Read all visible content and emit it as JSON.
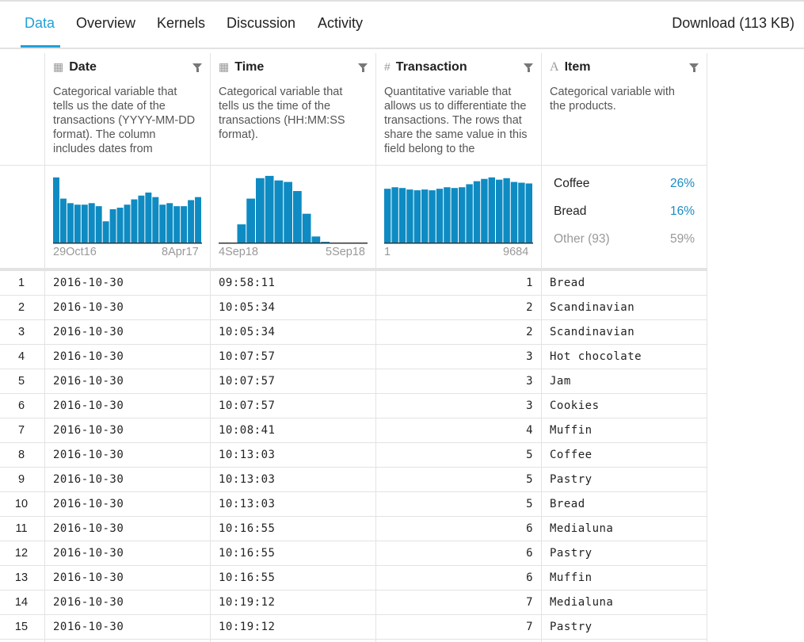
{
  "tabs": [
    {
      "label": "Data",
      "active": true
    },
    {
      "label": "Overview",
      "active": false
    },
    {
      "label": "Kernels",
      "active": false
    },
    {
      "label": "Discussion",
      "active": false
    },
    {
      "label": "Activity",
      "active": false
    }
  ],
  "download_label": "Download (113 KB)",
  "columns": [
    {
      "name": "Date",
      "icon": "calendar-icon",
      "description": "Categorical variable that tells us the date of the transactions (YYYY-MM-DD format). The column includes dates from",
      "axis_min": "29Oct16",
      "axis_max": "8Apr17"
    },
    {
      "name": "Time",
      "icon": "calendar-icon",
      "description": "Categorical variable that tells us the time of the transactions (HH:MM:SS format).",
      "axis_min": "4Sep18",
      "axis_max": "5Sep18"
    },
    {
      "name": "Transaction",
      "icon": "hash-icon",
      "description": "Quantitative variable that allows us to differentiate the transactions. The rows that share the same value in this field belong to the",
      "axis_min": "1",
      "axis_max": "9684"
    },
    {
      "name": "Item",
      "icon": "text-type-icon",
      "description": "Categorical variable with the products."
    }
  ],
  "histograms": {
    "date": [
      86,
      58,
      52,
      50,
      50,
      52,
      48,
      28,
      44,
      46,
      50,
      57,
      62,
      66,
      60,
      50,
      52,
      48,
      48,
      56,
      60
    ],
    "time": [
      0,
      0,
      24,
      58,
      85,
      88,
      82,
      80,
      68,
      38,
      8,
      1,
      0,
      0,
      0,
      0
    ],
    "transaction": [
      71,
      73,
      72,
      70,
      69,
      70,
      69,
      71,
      73,
      72,
      73,
      77,
      81,
      84,
      86,
      83,
      85,
      80,
      79,
      78
    ],
    "bar_color": "#0e8bc2"
  },
  "item_stats": [
    {
      "name": "Coffee",
      "pct": "26%"
    },
    {
      "name": "Bread",
      "pct": "16%"
    },
    {
      "name": "Other (93)",
      "pct": "59%"
    }
  ],
  "rows": [
    {
      "i": "1",
      "date": "2016-10-30",
      "time": "09:58:11",
      "tx": "1",
      "item": "Bread"
    },
    {
      "i": "2",
      "date": "2016-10-30",
      "time": "10:05:34",
      "tx": "2",
      "item": "Scandinavian"
    },
    {
      "i": "3",
      "date": "2016-10-30",
      "time": "10:05:34",
      "tx": "2",
      "item": "Scandinavian"
    },
    {
      "i": "4",
      "date": "2016-10-30",
      "time": "10:07:57",
      "tx": "3",
      "item": "Hot chocolate"
    },
    {
      "i": "5",
      "date": "2016-10-30",
      "time": "10:07:57",
      "tx": "3",
      "item": "Jam"
    },
    {
      "i": "6",
      "date": "2016-10-30",
      "time": "10:07:57",
      "tx": "3",
      "item": "Cookies"
    },
    {
      "i": "7",
      "date": "2016-10-30",
      "time": "10:08:41",
      "tx": "4",
      "item": "Muffin"
    },
    {
      "i": "8",
      "date": "2016-10-30",
      "time": "10:13:03",
      "tx": "5",
      "item": "Coffee"
    },
    {
      "i": "9",
      "date": "2016-10-30",
      "time": "10:13:03",
      "tx": "5",
      "item": "Pastry"
    },
    {
      "i": "10",
      "date": "2016-10-30",
      "time": "10:13:03",
      "tx": "5",
      "item": "Bread"
    },
    {
      "i": "11",
      "date": "2016-10-30",
      "time": "10:16:55",
      "tx": "6",
      "item": "Medialuna"
    },
    {
      "i": "12",
      "date": "2016-10-30",
      "time": "10:16:55",
      "tx": "6",
      "item": "Pastry"
    },
    {
      "i": "13",
      "date": "2016-10-30",
      "time": "10:16:55",
      "tx": "6",
      "item": "Muffin"
    },
    {
      "i": "14",
      "date": "2016-10-30",
      "time": "10:19:12",
      "tx": "7",
      "item": "Medialuna"
    },
    {
      "i": "15",
      "date": "2016-10-30",
      "time": "10:19:12",
      "tx": "7",
      "item": "Pastry"
    }
  ]
}
